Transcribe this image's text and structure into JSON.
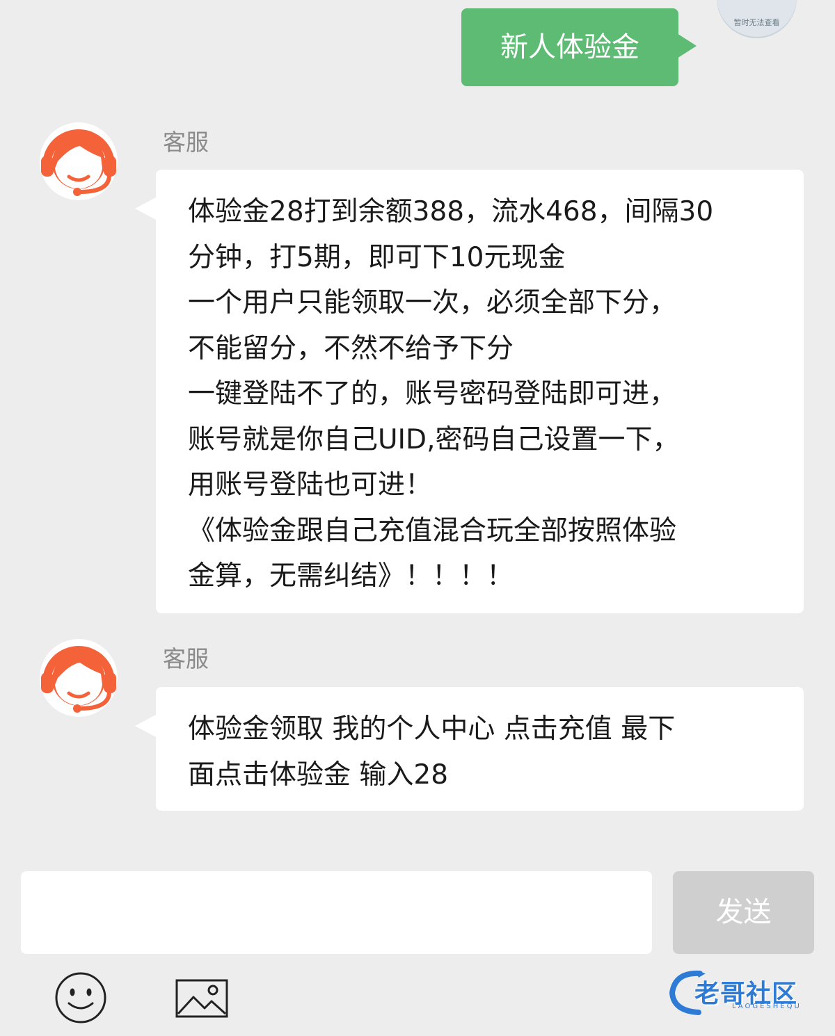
{
  "user_message": {
    "text": "新人体验金",
    "avatar_caption": "暂时无法查看",
    "bubble_color": "#5ebb74"
  },
  "messages": [
    {
      "sender": "客服",
      "avatar_icon": "customer-service-headset-icon",
      "lines": [
        "体验金28打到余额388，流水468，间隔30",
        "分钟，打5期，即可下10元现金",
        "一个用户只能领取一次，必须全部下分，",
        "不能留分，不然不给予下分",
        "一键登陆不了的，账号密码登陆即可进，",
        "账号就是你自己UID,密码自己设置一下，",
        "用账号登陆也可进！",
        "《体验金跟自己充值混合玩全部按照体验",
        "金算，无需纠结》！！！！"
      ]
    },
    {
      "sender": "客服",
      "avatar_icon": "customer-service-headset-icon",
      "lines": [
        "体验金领取 我的个人中心 点击充值 最下",
        "面点击体验金 输入28"
      ]
    }
  ],
  "composer": {
    "input_value": "",
    "send_label": "发送"
  },
  "toolbar": {
    "emoji_icon": "smiley-icon",
    "image_icon": "image-icon"
  },
  "watermark": {
    "text": "老哥社区",
    "subtext": "LAOGESHEQU"
  },
  "colors": {
    "background": "#ededed",
    "agent_avatar": "#f4623a",
    "send_button": "#cfcfcf"
  }
}
